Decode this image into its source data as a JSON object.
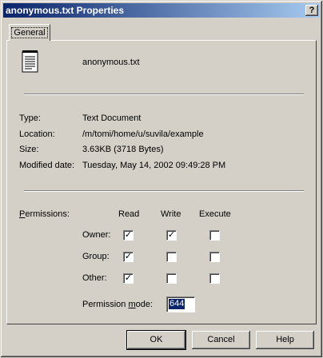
{
  "window": {
    "title": "anonymous.txt Properties",
    "help_label": "?"
  },
  "tabs": [
    {
      "label": "General"
    }
  ],
  "file": {
    "name": "anonymous.txt",
    "icon": "text-document-icon"
  },
  "info": {
    "type_label": "Type:",
    "type_value": "Text Document",
    "location_label": "Location:",
    "location_value": "/m/tomi/home/u/suvila/example",
    "size_label": "Size:",
    "size_value": "3.63KB (3718 Bytes)",
    "modified_label": "Modified date:",
    "modified_value": "Tuesday, May 14, 2002 09:49:28 PM"
  },
  "permissions": {
    "label_prefix": "P",
    "label_rest": "ermissions:",
    "columns": [
      "Read",
      "Write",
      "Execute"
    ],
    "rows": [
      {
        "label": "Owner:",
        "read": true,
        "write": true,
        "execute": false
      },
      {
        "label": "Group:",
        "read": true,
        "write": false,
        "execute": false
      },
      {
        "label": "Other:",
        "read": true,
        "write": false,
        "execute": false
      }
    ],
    "mode_label_before": "Permission ",
    "mode_label_underlined": "m",
    "mode_label_after": "ode:",
    "mode_value": "644",
    "check_glyph": "✓"
  },
  "buttons": {
    "ok": "OK",
    "cancel": "Cancel",
    "help": "Help"
  }
}
